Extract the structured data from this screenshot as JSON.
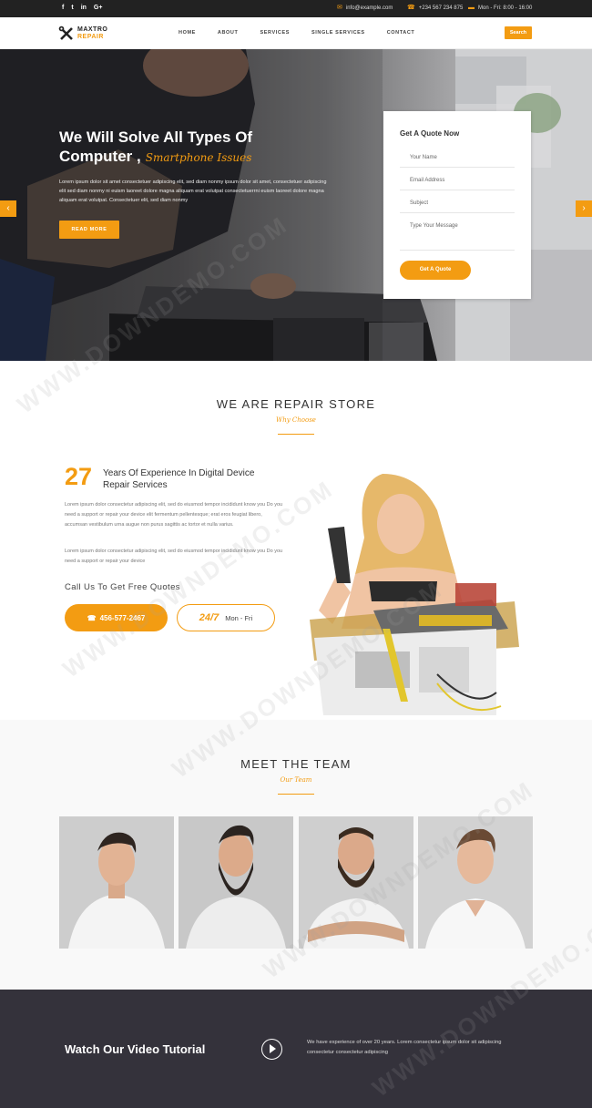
{
  "topbar": {
    "social": [
      "f",
      "t",
      "in",
      "G+"
    ],
    "email": "info@example.com",
    "phone": "+234 567 234 875",
    "hours": "Mon - Fri: 8:00 - 16:00"
  },
  "brand": {
    "line1": "MAXTRO",
    "line2": "REPAIR"
  },
  "nav": {
    "items": [
      "HOME",
      "ABOUT",
      "SERVICES",
      "SINGLE SERVICES",
      "CONTACT"
    ],
    "search_label": "Search"
  },
  "hero": {
    "title_line1": "We Will Solve All Types Of",
    "title_line2": "Computer ,",
    "title_script": "Smartphone Issues",
    "description": "Lorem ipsum dolor sit amet consectetuer adipiscing elit, sed diam nonmy ipsum dolor sit amet, consectetuer adipiscing elit sed diam nonmy ni euism laoreet dolore magna aliquam erat volutpat consectetuerrni euism laoreet dolore magna aliquam erat volutpat. Consectetuer elit, sed diam nonmy",
    "cta": "READ MORE",
    "prev_arrow": "‹",
    "next_arrow": "›"
  },
  "quote_form": {
    "title": "Get A Quote Now",
    "name_placeholder": "Your Name",
    "email_placeholder": "Email Address",
    "subject_placeholder": "Subject",
    "message_placeholder": "Type Your Message",
    "submit": "Get A Quote"
  },
  "about": {
    "title": "WE ARE REPAIR STORE",
    "subtitle": "Why Choose",
    "years_number": "27",
    "years_text": "Years Of Experience In Digital Device Repair Services",
    "para1": "Lorem ipsum dolor consectetur adipiscing elit, sed do eiusmod tempor incididunt know you Do you need a support or repair your device elit fermentum pellentesque; erat eros feugiat libero, accumsan vestibulum urna augue non purus sagittis ac tortor et nulla varius.",
    "para2": "Lorem ipsum dolor consectetur adipiscing elit, sed do eiusmod tempor incididunt know you Do you need a support or repair your device",
    "call_label": "Call Us To Get Free Quotes",
    "phone": "456-577-2467",
    "hours_big": "24/7",
    "hours_days": "Mon - Fri"
  },
  "team": {
    "title": "MEET THE TEAM",
    "subtitle": "Our Team"
  },
  "video": {
    "title": "Watch Our Video Tutorial",
    "text": "We have experience of over 20 years. Lorem consectetur ipsum dolor sit adipiscing consectetur consectetur adipiscing"
  },
  "watermark": "WWW.DOWNDEMO.COM",
  "colors": {
    "accent": "#f39c12",
    "dark": "#222222",
    "video_bg": "#34323b"
  }
}
